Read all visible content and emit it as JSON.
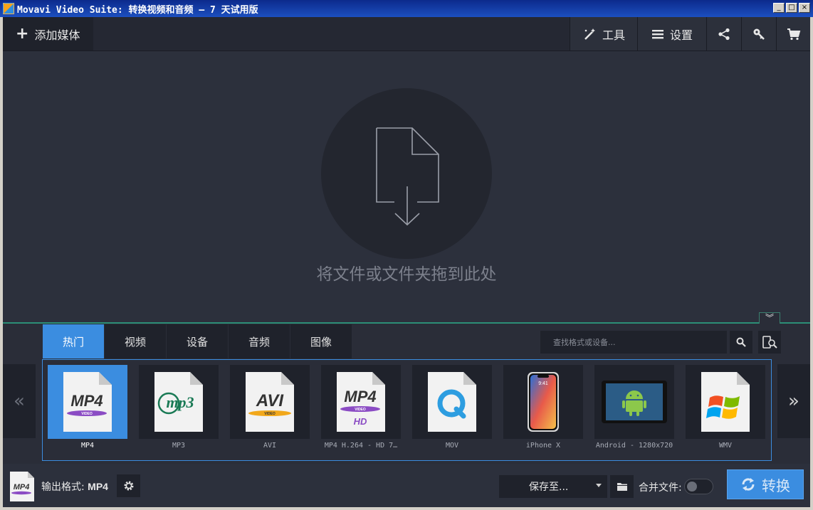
{
  "window": {
    "title": "Movavi Video Suite: 转换视频和音频 – 7 天试用版",
    "min": "_",
    "max": "□",
    "close": "×"
  },
  "toolbar": {
    "add_media_label": "添加媒体",
    "tools_label": "工具",
    "settings_label": "设置"
  },
  "dropzone": {
    "text": "将文件或文件夹拖到此处"
  },
  "panel": {
    "tabs": [
      {
        "label": "热门",
        "active": true
      },
      {
        "label": "视频",
        "active": false
      },
      {
        "label": "设备",
        "active": false
      },
      {
        "label": "音频",
        "active": false
      },
      {
        "label": "图像",
        "active": false
      }
    ],
    "search_placeholder": "查找格式或设备...",
    "prev_arrow": "«",
    "next_arrow": "»",
    "collapse_glyph": "︾",
    "formats": [
      {
        "label": "MP4",
        "icon": "mp4-video-icon",
        "selected": true
      },
      {
        "label": "MP3",
        "icon": "mp3-audio-icon",
        "selected": false
      },
      {
        "label": "AVI",
        "icon": "avi-video-icon",
        "selected": false
      },
      {
        "label": "MP4 H.264 - HD 7…",
        "icon": "mp4-hd-video-icon",
        "selected": false
      },
      {
        "label": "MOV",
        "icon": "quicktime-mov-icon",
        "selected": false
      },
      {
        "label": "iPhone X",
        "icon": "iphone-icon",
        "selected": false
      },
      {
        "label": "Android - 1280x720",
        "icon": "android-tablet-icon",
        "selected": false
      },
      {
        "label": "WMV",
        "icon": "windows-media-icon",
        "selected": false
      }
    ],
    "icon_text": {
      "mp4": "MP4",
      "video": "VIDEO",
      "mp3": "mp3",
      "avi": "AVI",
      "hd": "HD",
      "phone_time": "9:41"
    }
  },
  "bottom": {
    "output_prefix": "输出格式:",
    "output_value": "MP4",
    "save_to_label": "保存至...",
    "merge_label": "合并文件:",
    "merge_enabled": false,
    "convert_label": "转换"
  },
  "colors": {
    "accent": "#3b8de0",
    "background": "#2c303c",
    "divider": "#2c8f77"
  }
}
